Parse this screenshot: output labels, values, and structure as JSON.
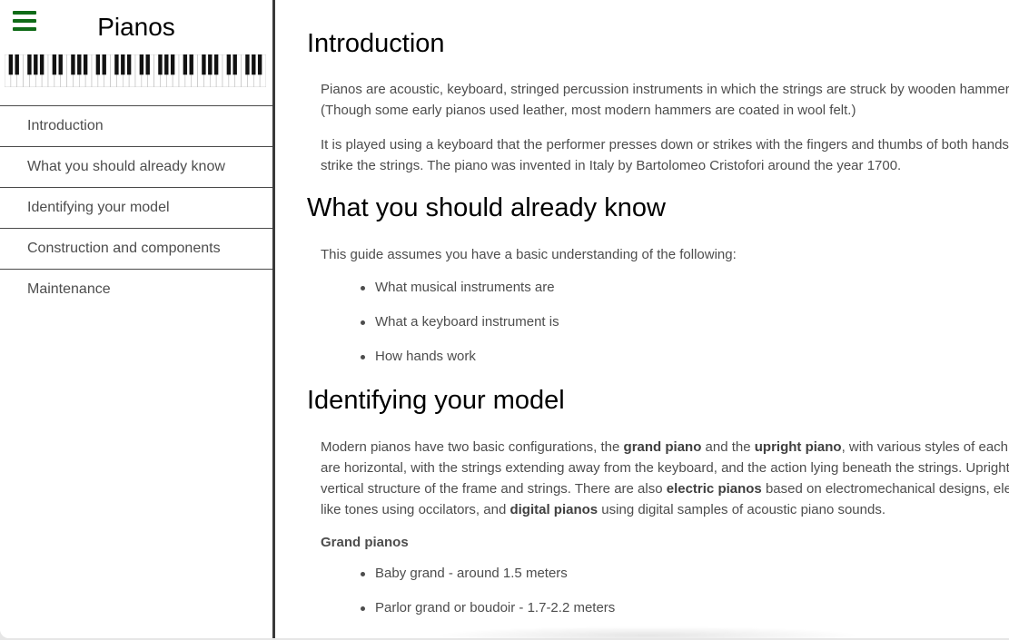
{
  "site": {
    "title": "Pianos"
  },
  "nav": {
    "items": [
      "Introduction",
      "What you should already know",
      "Identifying your model",
      "Construction and components",
      "Maintenance"
    ]
  },
  "colors": {
    "menu_icon": "#0f6b17",
    "divider": "#3a3a3a",
    "text": "#4d4d4d"
  },
  "icons": {
    "menu": "hamburger-menu-icon",
    "keyboard": "piano-keyboard-image"
  },
  "content": {
    "intro": {
      "title": "Introduction",
      "p1_line1": "Pianos are acoustic, keyboard, stringed percussion instruments in which the strings are struck by wooden hammers",
      "p1_line2": "(Though some early pianos used leather, most modern hammers are coated in wool felt.)",
      "p2_line1": "It is played using a keyboard that the performer presses down or strikes with the fingers and thumbs of both hands to cause the hammers to",
      "p2_line2": "strike the strings. The piano was invented in Italy by Bartolomeo Cristofori around the year 1700."
    },
    "know": {
      "title": "What you should already know",
      "intro": "This guide assumes you have a basic understanding of the following:",
      "items": [
        "What musical instruments are",
        "What a keyboard instrument is",
        "How hands work"
      ]
    },
    "model": {
      "title": "Identifying your model",
      "l1_a": "Modern pianos have two basic configurations, the ",
      "l1_b": "grand piano",
      "l1_c": " and the ",
      "l1_d": "upright piano",
      "l1_e": ", with various styles of each. Grand pianos have the frame and strings",
      "l2": "are horizontal, with the strings extending away from the keyboard, and the action lying beneath the strings. Upright pianos have a",
      "l3_a": "vertical structure of the frame and strings. There are also ",
      "l3_b": "electric pianos",
      "l3_c": " based on electromechanical designs, electronic pianos that synthesize piano-",
      "l4_a": "like tones using occilators, and ",
      "l4_b": "digital pianos",
      "l4_c": " using digital samples of acoustic piano sounds.",
      "subheading": "Grand pianos",
      "items": [
        "Baby grand - around 1.5 meters",
        "Parlor grand or boudoir - 1.7-2.2 meters"
      ]
    }
  }
}
